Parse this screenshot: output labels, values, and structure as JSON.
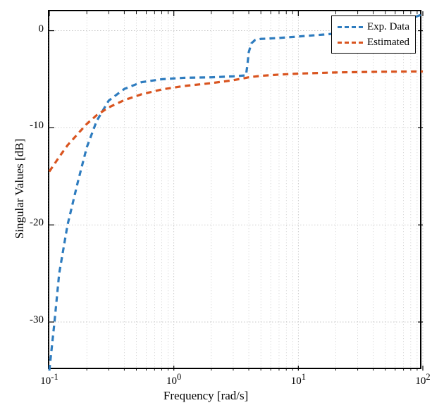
{
  "chart_data": {
    "type": "line",
    "xscale": "log",
    "x_ticks": [
      0.1,
      1,
      10,
      100
    ],
    "x_tick_labels": [
      "10^{-1}",
      "10^{0}",
      "10^{1}",
      "10^{2}"
    ],
    "y_ticks": [
      -30,
      -20,
      -10,
      0
    ],
    "xlim": [
      0.1,
      100
    ],
    "ylim": [
      -35,
      2
    ],
    "grid": true,
    "title": "",
    "xlabel": "Frequency [rad/s]",
    "ylabel": "Singular Values [dB]",
    "legend_position": "upper right",
    "series": [
      {
        "name": "Exp. Data",
        "color": "#2e7cbf",
        "dash": "8,6",
        "x": [
          0.1,
          0.11,
          0.12,
          0.14,
          0.17,
          0.2,
          0.24,
          0.3,
          0.4,
          0.55,
          0.8,
          1.2,
          2.0,
          3.0,
          3.8,
          3.9,
          4.0,
          4.2,
          4.5,
          5.0,
          7.0,
          10,
          20,
          40,
          70,
          100
        ],
        "y": [
          -35,
          -30,
          -25,
          -20,
          -15.5,
          -12,
          -9.3,
          -7.2,
          -6.0,
          -5.3,
          -5.0,
          -4.85,
          -4.8,
          -4.7,
          -4.6,
          -3.5,
          -2.2,
          -1.3,
          -0.95,
          -0.85,
          -0.75,
          -0.6,
          -0.3,
          0.3,
          1.0,
          1.7
        ]
      },
      {
        "name": "Estimated",
        "color": "#d9541f",
        "dash": "8,6",
        "x": [
          0.1,
          0.12,
          0.14,
          0.17,
          0.2,
          0.24,
          0.3,
          0.4,
          0.55,
          0.8,
          1.2,
          2.0,
          3.0,
          4.0,
          5.0,
          7.0,
          10,
          20,
          40,
          70,
          100
        ],
        "y": [
          -14.5,
          -13.0,
          -11.8,
          -10.6,
          -9.6,
          -8.7,
          -7.9,
          -7.15,
          -6.55,
          -6.05,
          -5.7,
          -5.4,
          -5.1,
          -4.8,
          -4.65,
          -4.52,
          -4.42,
          -4.3,
          -4.24,
          -4.21,
          -4.2
        ]
      }
    ]
  },
  "legend": {
    "items": [
      {
        "label": "Exp. Data",
        "color": "#2e7cbf"
      },
      {
        "label": "Estimated",
        "color": "#d9541f"
      }
    ]
  },
  "axes": {
    "xlabel": "Frequency [rad/s]",
    "ylabel": "Singular Values [dB]",
    "x_tick_html": [
      "10<sup>-1</sup>",
      "10<sup>0</sup>",
      "10<sup>1</sup>",
      "10<sup>2</sup>"
    ],
    "y_tick_html": [
      "-30",
      "-20",
      "-10",
      "0"
    ]
  }
}
